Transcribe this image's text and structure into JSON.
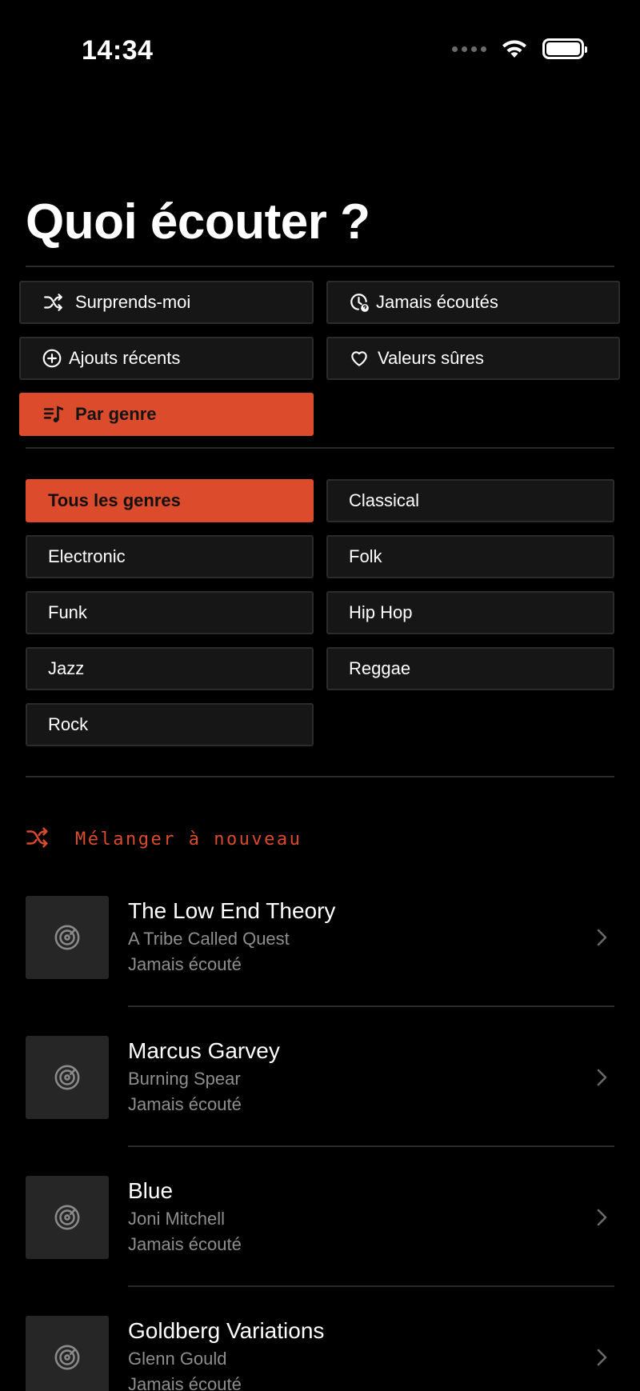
{
  "status_bar": {
    "time": "14:34"
  },
  "page_title": "Quoi écouter ?",
  "modes": [
    {
      "label": "Surprends-moi",
      "icon": "shuffle-icon"
    },
    {
      "label": "Jamais écoutés",
      "icon": "unplayed-icon"
    },
    {
      "label": "Ajouts récents",
      "icon": "plus-circle-icon"
    },
    {
      "label": "Valeurs sûres",
      "icon": "heart-icon"
    },
    {
      "label": "Par genre",
      "icon": "music-list-icon",
      "active": true
    }
  ],
  "genres": [
    {
      "label": "Tous les genres",
      "active": true
    },
    {
      "label": "Classical"
    },
    {
      "label": "Electronic"
    },
    {
      "label": "Folk"
    },
    {
      "label": "Funk"
    },
    {
      "label": "Hip Hop"
    },
    {
      "label": "Jazz"
    },
    {
      "label": "Reggae"
    },
    {
      "label": "Rock"
    }
  ],
  "reshuffle_label": "Mélanger à nouveau",
  "albums": [
    {
      "title": "The Low End Theory",
      "artist": "A Tribe Called Quest",
      "status": "Jamais écouté"
    },
    {
      "title": "Marcus Garvey",
      "artist": "Burning Spear",
      "status": "Jamais écouté"
    },
    {
      "title": "Blue",
      "artist": "Joni Mitchell",
      "status": "Jamais écouté"
    },
    {
      "title": "Goldberg Variations",
      "artist": "Glenn Gould",
      "status": "Jamais écouté"
    }
  ],
  "colors": {
    "accent": "#db4b2c",
    "background": "#000000",
    "button": "#161616",
    "muted_text": "#8e8e8e"
  }
}
